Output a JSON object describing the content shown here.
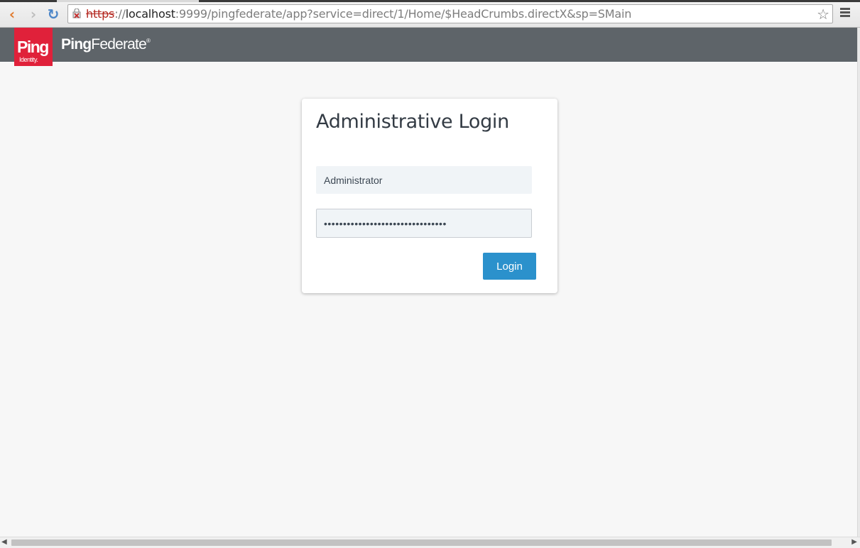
{
  "browser": {
    "url": {
      "scheme": "https",
      "separator": "://",
      "host": "localhost",
      "rest": ":9999/pingfederate/app?service=direct/1/Home/$HeadCrumbs.directX&sp=SMain"
    },
    "icons": {
      "back": "‹",
      "forward": "›",
      "reload": "↻",
      "star": "☆"
    }
  },
  "header": {
    "logo_main": "Ping",
    "logo_sub": "Identity.",
    "product_bold": "Ping",
    "product_rest": "Federate",
    "product_mark": "®"
  },
  "login": {
    "title": "Administrative Login",
    "username_value": "Administrator",
    "password_value": "••••••••••••••••••••••••••••••••",
    "button_label": "Login"
  },
  "scrollbar": {
    "left_arrow": "◀",
    "right_arrow": "▶"
  },
  "colors": {
    "header_bg": "#5e6469",
    "logo_red": "#e0213a",
    "button_blue": "#2b91cc",
    "page_bg": "#f7f7f7"
  }
}
